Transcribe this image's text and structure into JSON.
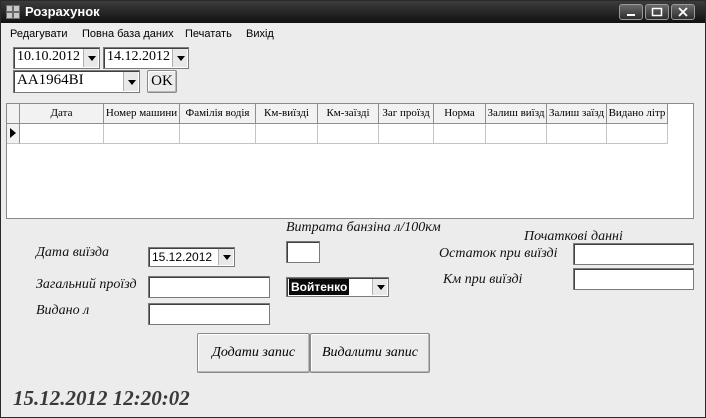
{
  "window": {
    "title": "Розрахунок",
    "icon": "app-grid-icon"
  },
  "menu": [
    "Редагувати",
    "Повна база даних",
    "Печатать",
    "Вихід"
  ],
  "filters": {
    "date_from": "10.10.2012",
    "date_to": "14.12.2012",
    "car_number": "АА1964ВІ",
    "ok_label": "OK"
  },
  "table": {
    "columns": [
      "Дата",
      "Номер машини",
      "Фамілія водія",
      "Км-виїзді",
      "Км-заїзді",
      "Заг проїзд",
      "Норма",
      "Залиш виїзд",
      "Залиш заїзд",
      "Видано літр"
    ],
    "rows": [
      [
        "",
        "",
        "",
        "",
        "",
        "",
        "",
        "",
        "",
        ""
      ]
    ]
  },
  "form": {
    "departure_date_label": "Дата виїзда",
    "departure_date_value": "15.12.2012",
    "total_distance_label": "Загальний проїзд",
    "issued_label": "Видано л",
    "fuel_rate_label": "Витрата банзіна л/100км",
    "driver_value": "Войтенко",
    "initial_data_label": "Початкові данні",
    "remainder_label": "Остаток при виїзді",
    "km_label": "Км при виїзді"
  },
  "buttons": {
    "add": "Додати запис",
    "delete": "Видалити запис"
  },
  "status": {
    "datetime": "15.12.2012 12:20:02"
  }
}
